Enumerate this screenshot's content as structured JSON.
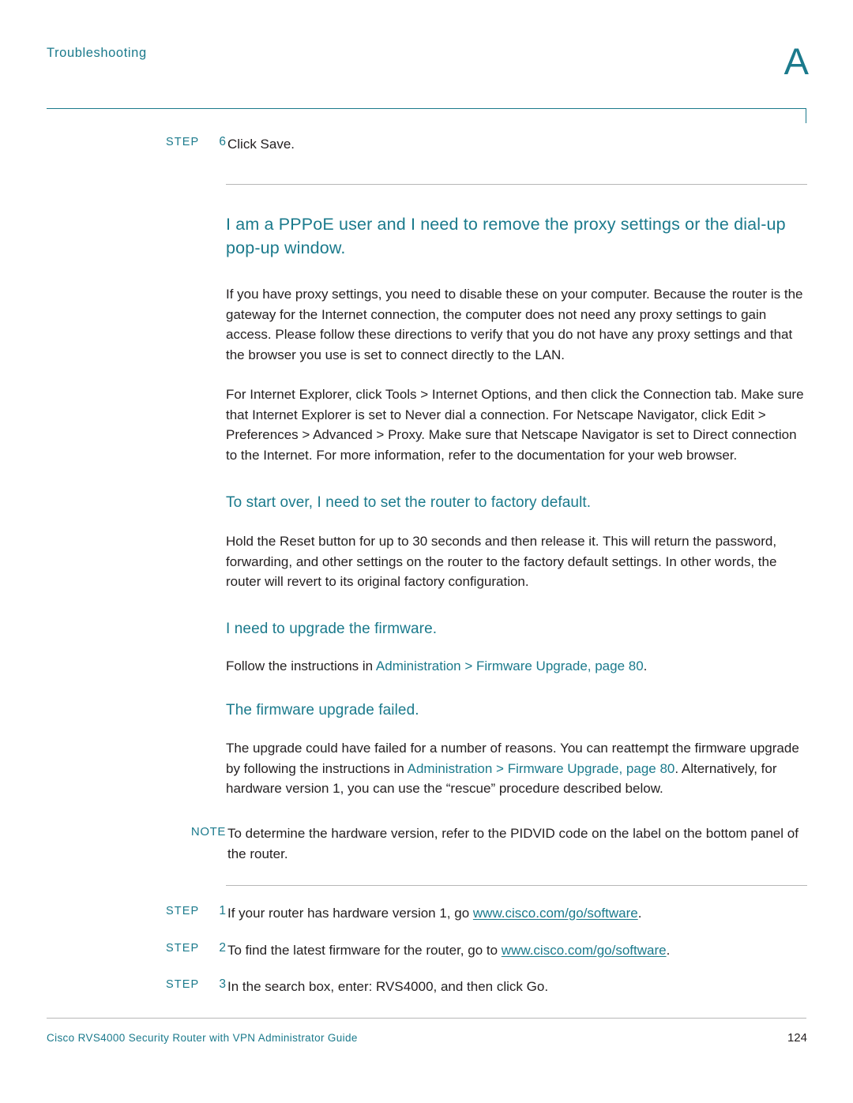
{
  "header": {
    "chapter": "Troubleshooting",
    "appendix_letter": "A"
  },
  "blocks": {
    "step6": {
      "label": "STEP",
      "num": "6",
      "text": "Click Save."
    },
    "heading_pppoe": "I am a PPPoE user and I need to remove the proxy settings or the dial-up pop-up window.",
    "para_pppoe_1": "If you have proxy settings, you need to disable these on your computer. Because the router is the gateway for the Internet connection, the computer does not need any proxy settings to gain access. Please follow these directions to verify that you do not have any proxy settings and that the browser you use is set to connect directly to the LAN.",
    "para_pppoe_2": "For Internet Explorer, click Tools > Internet Options, and then click the Connection tab. Make sure that Internet Explorer is set to Never dial a connection. For Netscape Navigator, click Edit > Preferences > Advanced > Proxy. Make sure that Netscape Navigator is set to Direct connection to the Internet. For more information, refer to the documentation for your web browser.",
    "heading_factory": "To start over, I need to set the router to factory default.",
    "para_factory": "Hold the Reset button for up to 30 seconds and then release it. This will return the password, forwarding, and other settings on the router to the factory default settings. In other words, the router will revert to its original factory configuration.",
    "heading_upgrade": "I need to upgrade the firmware.",
    "para_upgrade_prefix": "Follow the instructions in ",
    "para_upgrade_link": "Administration > Firmware Upgrade, page 80",
    "para_upgrade_suffix": ".",
    "heading_failed": "The firmware upgrade failed.",
    "para_failed_1": "The upgrade could have failed for a number of reasons. You can reattempt the firmware upgrade by following the instructions in ",
    "para_failed_link": "Administration > Firmware Upgrade, page 80",
    "para_failed_2": ". Alternatively, for hardware version 1, you can use the “rescue” procedure described below.",
    "note": {
      "label": "NOTE",
      "text": "To determine the hardware version, refer to the PIDVID code on the label on the bottom panel of the router."
    },
    "step1": {
      "label": "STEP",
      "num": "1",
      "text_prefix": "If your router has hardware version 1, go ",
      "link": "www.cisco.com/go/software",
      "text_suffix": "."
    },
    "step2": {
      "label": "STEP",
      "num": "2",
      "text_prefix": "To find the latest firmware for the router, go to ",
      "link": "www.cisco.com/go/software",
      "text_suffix": "."
    },
    "step3": {
      "label": "STEP",
      "num": "3",
      "text": "In the search box, enter: RVS4000, and then click Go."
    }
  },
  "footer": {
    "title": "Cisco RVS4000 Security Router with VPN Administrator Guide",
    "page": "124"
  },
  "colors": {
    "accent": "#1b7a8c",
    "body": "#231f20",
    "rule": "#b7b7b7"
  }
}
